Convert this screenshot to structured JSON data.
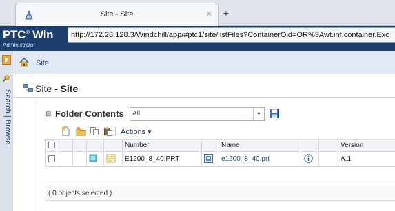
{
  "browser": {
    "tab_title": "Site - Site",
    "tab_close": "✕",
    "new_tab": "+"
  },
  "header": {
    "brand": "PTC",
    "brand_mark": "®",
    "brand_suffix": " Win",
    "role": "Administrator",
    "url": "http://172.28.128.3/Windchill/app/#ptc1/site/listFiles?ContainerOid=OR%3Awt.inf.container.Exc"
  },
  "navigator": {
    "tabs_label": "Search | Browse"
  },
  "breadcrumb": {
    "label": "Site"
  },
  "page": {
    "title_prefix": "Site - ",
    "title_bold": "Site"
  },
  "folder_panel": {
    "collapse_glyph": "⊟",
    "title": "Folder Contents",
    "view_value": "All",
    "view_caret": "▾",
    "actions_label": "Actions ▾"
  },
  "table": {
    "columns": [
      "",
      "",
      "",
      "",
      "",
      "Number",
      "",
      "Name",
      "",
      "",
      "Version"
    ],
    "rows": [
      {
        "number": "E1200_8_40.PRT",
        "name": "e1200_8_40.prt",
        "version": "A.1"
      }
    ],
    "selection_status": "( 0 objects selected )"
  },
  "colors": {
    "header_bg": "#1d3f6e",
    "accent_orange": "#e9a13a",
    "link": "#1d4a8a"
  }
}
